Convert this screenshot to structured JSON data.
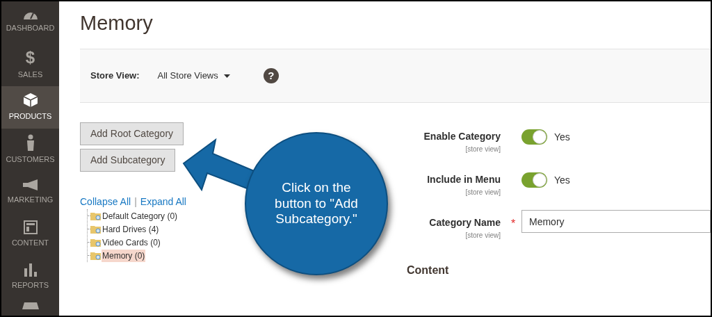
{
  "sidebar": {
    "items": [
      {
        "label": "DASHBOARD",
        "selected": false
      },
      {
        "label": "SALES",
        "glyph": "$",
        "selected": false
      },
      {
        "label": "PRODUCTS",
        "selected": true
      },
      {
        "label": "CUSTOMERS",
        "selected": false
      },
      {
        "label": "MARKETING",
        "selected": false
      },
      {
        "label": "CONTENT",
        "selected": false
      },
      {
        "label": "REPORTS",
        "selected": false
      }
    ]
  },
  "page_title": "Memory",
  "store_view": {
    "label": "Store View:",
    "value": "All Store Views",
    "help": "?"
  },
  "buttons": [
    "Add Root Category",
    "Add Subcategory"
  ],
  "tree_links": [
    "Collapse All",
    "Expand All"
  ],
  "tree_separator": "|",
  "tree": [
    {
      "label": "Default Category (0)",
      "selected": false
    },
    {
      "label": "Hard Drives (4)",
      "selected": false
    },
    {
      "label": "Video Cards (0)",
      "selected": false
    },
    {
      "label": "Memory (0)",
      "selected": true
    }
  ],
  "fields": [
    {
      "kind": "toggle",
      "label": "Enable Category",
      "scope": "[store view]",
      "on": true,
      "value": "Yes"
    },
    {
      "kind": "toggle",
      "label": "Include in Menu",
      "scope": "[store view]",
      "on": true,
      "value": "Yes"
    },
    {
      "kind": "text",
      "label": "Category Name",
      "scope": "[store view]",
      "required_mark": "*",
      "value": "Memory"
    }
  ],
  "section_title": "Content",
  "callout": {
    "text": "Click on the button to \"Add Subcategory.\""
  }
}
